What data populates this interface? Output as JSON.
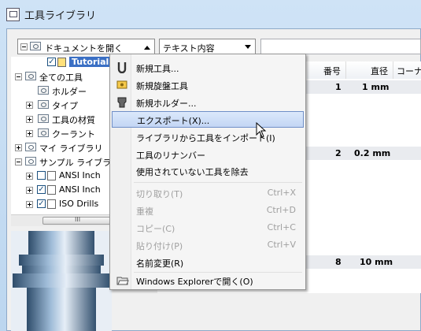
{
  "window": {
    "title": "工具ライブラリ"
  },
  "toolbar": {
    "library_combo": "ドキュメントを開く",
    "field_combo": "テキスト内容",
    "search_value": ""
  },
  "tree": {
    "items": [
      {
        "label": "ドキュメントを開く",
        "expander": "minus",
        "icon": "folder-open-icon"
      },
      {
        "label": "Tutorial",
        "checked": true,
        "selected": true
      },
      {
        "label": "全ての工具",
        "expander": "minus"
      },
      {
        "label": "ホルダー"
      },
      {
        "label": "タイプ",
        "expander": "plus"
      },
      {
        "label": "工具の材質",
        "expander": "plus"
      },
      {
        "label": "クーラント",
        "expander": "plus"
      },
      {
        "label": "マイ ライブラリ",
        "expander": "plus"
      },
      {
        "label": "サンプル ライブラリ",
        "expander": "minus"
      },
      {
        "label": "ANSI Inch",
        "checked": false
      },
      {
        "label": "ANSI Inch",
        "checked": true
      },
      {
        "label": "ISO Drills",
        "checked": true
      }
    ]
  },
  "table": {
    "headers": [
      "番号",
      "直径",
      "コーナ"
    ],
    "rows": [
      {
        "number": "1",
        "diameter": "1 mm"
      },
      {
        "number": "2",
        "diameter": "0.2 mm"
      },
      {
        "number": "8",
        "diameter": "10 mm"
      }
    ],
    "scroll_label": "III"
  },
  "menu": {
    "items": [
      {
        "label": "新規工具...",
        "icon": "new-tool-icon"
      },
      {
        "label": "新規旋盤工具",
        "icon": "lathe-tool-icon"
      },
      {
        "label": "新規ホルダー...",
        "icon": "holder-icon"
      },
      {
        "label": "エクスポート(X)...",
        "highlighted": true
      },
      {
        "label": "ライブラリから工具をインポート(I)"
      },
      {
        "label": "工具のリナンバー"
      },
      {
        "label": "使用されていない工具を除去"
      },
      {
        "label": "切り取り(T)",
        "shortcut": "Ctrl+X",
        "disabled": true
      },
      {
        "label": "重複",
        "shortcut": "Ctrl+D",
        "disabled": true
      },
      {
        "label": "コピー(C)",
        "shortcut": "Ctrl+C",
        "disabled": true
      },
      {
        "label": "貼り付け(P)",
        "shortcut": "Ctrl+V",
        "disabled": true
      },
      {
        "label": "名前変更(R)"
      },
      {
        "label": "Windows Explorerで開く(O)",
        "icon": "folder-open-icon"
      }
    ]
  },
  "colors": {
    "highlight": "#3a6fc4",
    "menu_hover": "#c3d6f4",
    "title_bg": "#cfe3f6"
  }
}
